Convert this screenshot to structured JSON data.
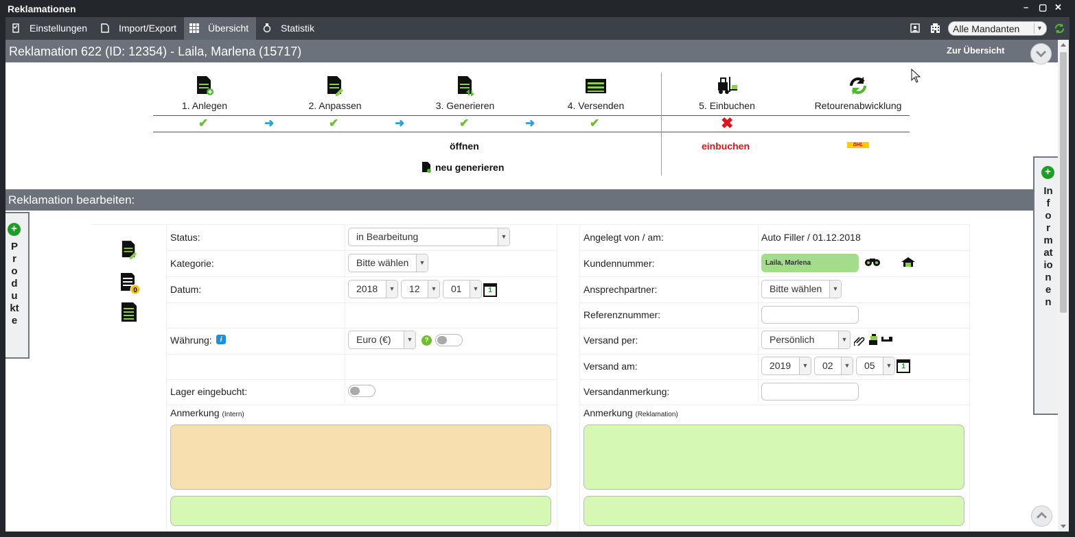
{
  "window": {
    "title": "Reklamationen"
  },
  "menu": {
    "items": [
      {
        "label": "Einstellungen",
        "icon": "settings-checklist-icon"
      },
      {
        "label": "Import/Export",
        "icon": "document-icon"
      },
      {
        "label": "Übersicht",
        "icon": "grid-icon"
      },
      {
        "label": "Statistik",
        "icon": "statistics-icon"
      }
    ],
    "mandant_select": "Alle Mandanten"
  },
  "header": {
    "title": "Reklamation 622 (ID: 12354) - Laila, Marlena (15717)",
    "back_link": "Zur Übersicht"
  },
  "workflow": {
    "steps": [
      {
        "label": "1. Anlegen",
        "status": "done"
      },
      {
        "label": "2. Anpassen",
        "status": "done"
      },
      {
        "label": "3. Generieren",
        "status": "done"
      },
      {
        "label": "4. Versenden",
        "status": "done"
      },
      {
        "label": "5. Einbuchen",
        "status": "open"
      },
      {
        "label": "Retourenabwicklung",
        "status": ""
      }
    ],
    "open_link": "öffnen",
    "regenerate_link": "neu generieren",
    "book_link": "einbuchen",
    "carrier_logo": "DHL"
  },
  "section": {
    "title": "Reklamation bearbeiten:"
  },
  "sidetabs": {
    "left": "Produkte",
    "right": "Informationen"
  },
  "form": {
    "status": {
      "label": "Status:",
      "value": "in Bearbeitung"
    },
    "kategorie": {
      "label": "Kategorie:",
      "value": "Bitte wählen"
    },
    "datum": {
      "label": "Datum:",
      "year": "2018",
      "month": "12",
      "day": "01",
      "cal_day": "1"
    },
    "waehrung": {
      "label": "Währung:",
      "value": "Euro (€)"
    },
    "lager": {
      "label": "Lager eingebucht:"
    },
    "anmerkung_intern": {
      "label": "Anmerkung",
      "sub": "(Intern)"
    },
    "angelegt": {
      "label": "Angelegt von / am:",
      "value": "Auto Filler / 01.12.2018"
    },
    "kundennummer": {
      "label": "Kundennummer:",
      "value": "Laila, Marlena"
    },
    "ansprechpartner": {
      "label": "Ansprechpartner:",
      "value": "Bitte wählen"
    },
    "referenz": {
      "label": "Referenznummer:",
      "value": ""
    },
    "versand_per": {
      "label": "Versand per:",
      "value": "Persönlich"
    },
    "versand_am": {
      "label": "Versand am:",
      "year": "2019",
      "month": "02",
      "day": "05",
      "cal_day": "1"
    },
    "versandanmerkung": {
      "label": "Versandanmerkung:",
      "value": ""
    },
    "anmerkung_reklamation": {
      "label": "Anmerkung",
      "sub": "(Reklamation)"
    },
    "info_glyph": "i",
    "help_glyph": "?",
    "badge_count": "0"
  },
  "colors": {
    "green": "#6cbf2a",
    "blue_arrow": "#2f9fd8",
    "red": "#e0141e",
    "textarea_orange": "#f8dfb0",
    "textarea_green": "#d5f8b4",
    "header_gray": "#6b727c"
  }
}
